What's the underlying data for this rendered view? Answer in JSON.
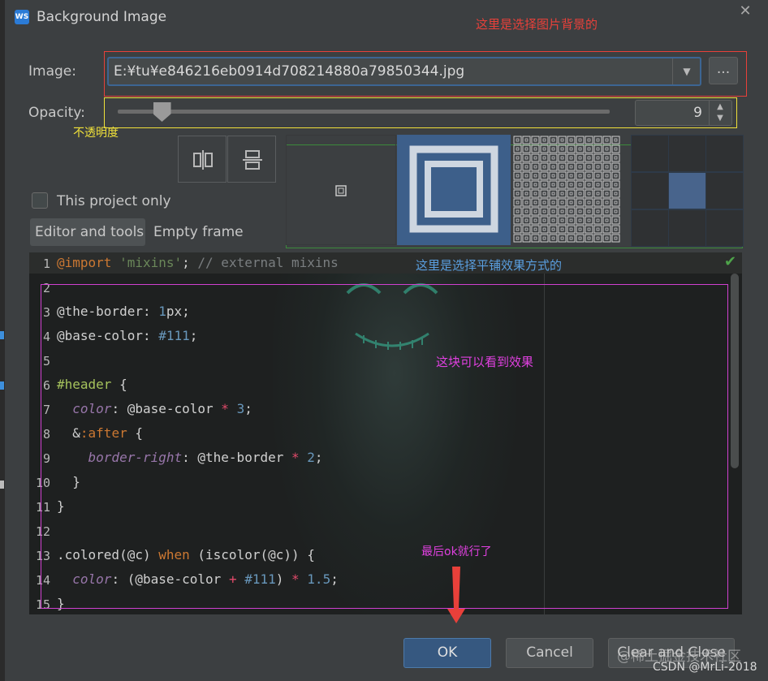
{
  "dialog": {
    "title": "Background Image",
    "close_icon": "close-icon",
    "app_icon": "webstorm-icon"
  },
  "annotations": {
    "top_right": "这里是选择图片背景的",
    "opacity_note": "不透明度",
    "tile_note": "这里是选择平铺效果方式的",
    "preview_note": "这块可以看到效果",
    "ok_note": "最后ok就行了"
  },
  "image": {
    "label": "Image:",
    "path_value": "E:¥tu¥e846216eb0914d708214880a79850344.jpg",
    "browse_label": "..."
  },
  "opacity": {
    "label": "Opacity:",
    "value": "9",
    "slider_fraction": 0.09
  },
  "options": {
    "this_project_only": "This project only",
    "tab_editor_tools": "Editor and tools",
    "tab_empty_frame": "Empty frame"
  },
  "code_lines": [
    {
      "num": "1",
      "text": "@import 'mixins'; // external mixins"
    },
    {
      "num": "2",
      "text": ""
    },
    {
      "num": "3",
      "text": "@the-border: 1px;"
    },
    {
      "num": "4",
      "text": "@base-color: #111;"
    },
    {
      "num": "5",
      "text": ""
    },
    {
      "num": "6",
      "text": "#header {"
    },
    {
      "num": "7",
      "text": "  color: @base-color * 3;"
    },
    {
      "num": "8",
      "text": "  &:after {"
    },
    {
      "num": "9",
      "text": "    border-right: @the-border * 2;"
    },
    {
      "num": "10",
      "text": "  }"
    },
    {
      "num": "11",
      "text": "}"
    },
    {
      "num": "12",
      "text": ""
    },
    {
      "num": "13",
      "text": ".colored(@c) when (iscolor(@c)) {"
    },
    {
      "num": "14",
      "text": "  color: (@base-color + #111) * 1.5;"
    },
    {
      "num": "15",
      "text": "}"
    }
  ],
  "buttons": {
    "ok": "OK",
    "cancel": "Cancel",
    "clear_and_close": "Clear and Close"
  },
  "watermark": {
    "line1": "@稀土掘金技术社区",
    "line2": "CSDN @MrLi-2018"
  },
  "colors": {
    "accent_blue": "#365880",
    "annot_red": "#e8403a",
    "annot_yellow": "#f0e13a",
    "annot_magenta": "#e040e0"
  }
}
